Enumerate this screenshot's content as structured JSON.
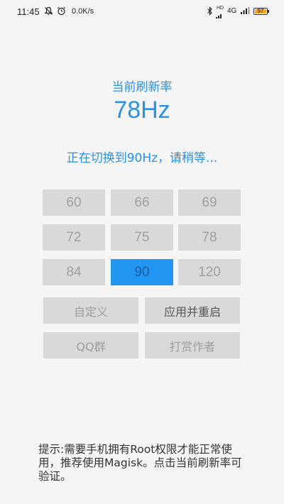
{
  "status_bar": {
    "time": "11:45",
    "net_speed": "0.0K/s",
    "network": "4G",
    "hd": "HD",
    "battery": "97",
    "battery_level": 0.97,
    "icons": [
      "mute-icon",
      "alarm-icon",
      "bluetooth-icon",
      "hd-icon",
      "signal-icon",
      "battery-icon"
    ]
  },
  "current": {
    "label": "当前刷新率",
    "value": "78Hz"
  },
  "status_message": "正在切换到90Hz，请稍等...",
  "rates": [
    {
      "label": "60",
      "selected": false
    },
    {
      "label": "66",
      "selected": false
    },
    {
      "label": "69",
      "selected": false
    },
    {
      "label": "72",
      "selected": false
    },
    {
      "label": "75",
      "selected": false
    },
    {
      "label": "78",
      "selected": false
    },
    {
      "label": "84",
      "selected": false
    },
    {
      "label": "90",
      "selected": true
    },
    {
      "label": "120",
      "selected": false
    }
  ],
  "actions": {
    "custom": "自定义",
    "apply_restart": "应用并重启",
    "qq_group": "QQ群",
    "donate": "打赏作者"
  },
  "hint": "提示:需要手机拥有Root权限才能正常使用，推荐使用Magisk。点击当前刷新率可验证。",
  "colors": {
    "accent": "#2a91e6",
    "selected_button": "#2196f3",
    "button": "#d9d9d9",
    "background": "#f5f5f5"
  }
}
